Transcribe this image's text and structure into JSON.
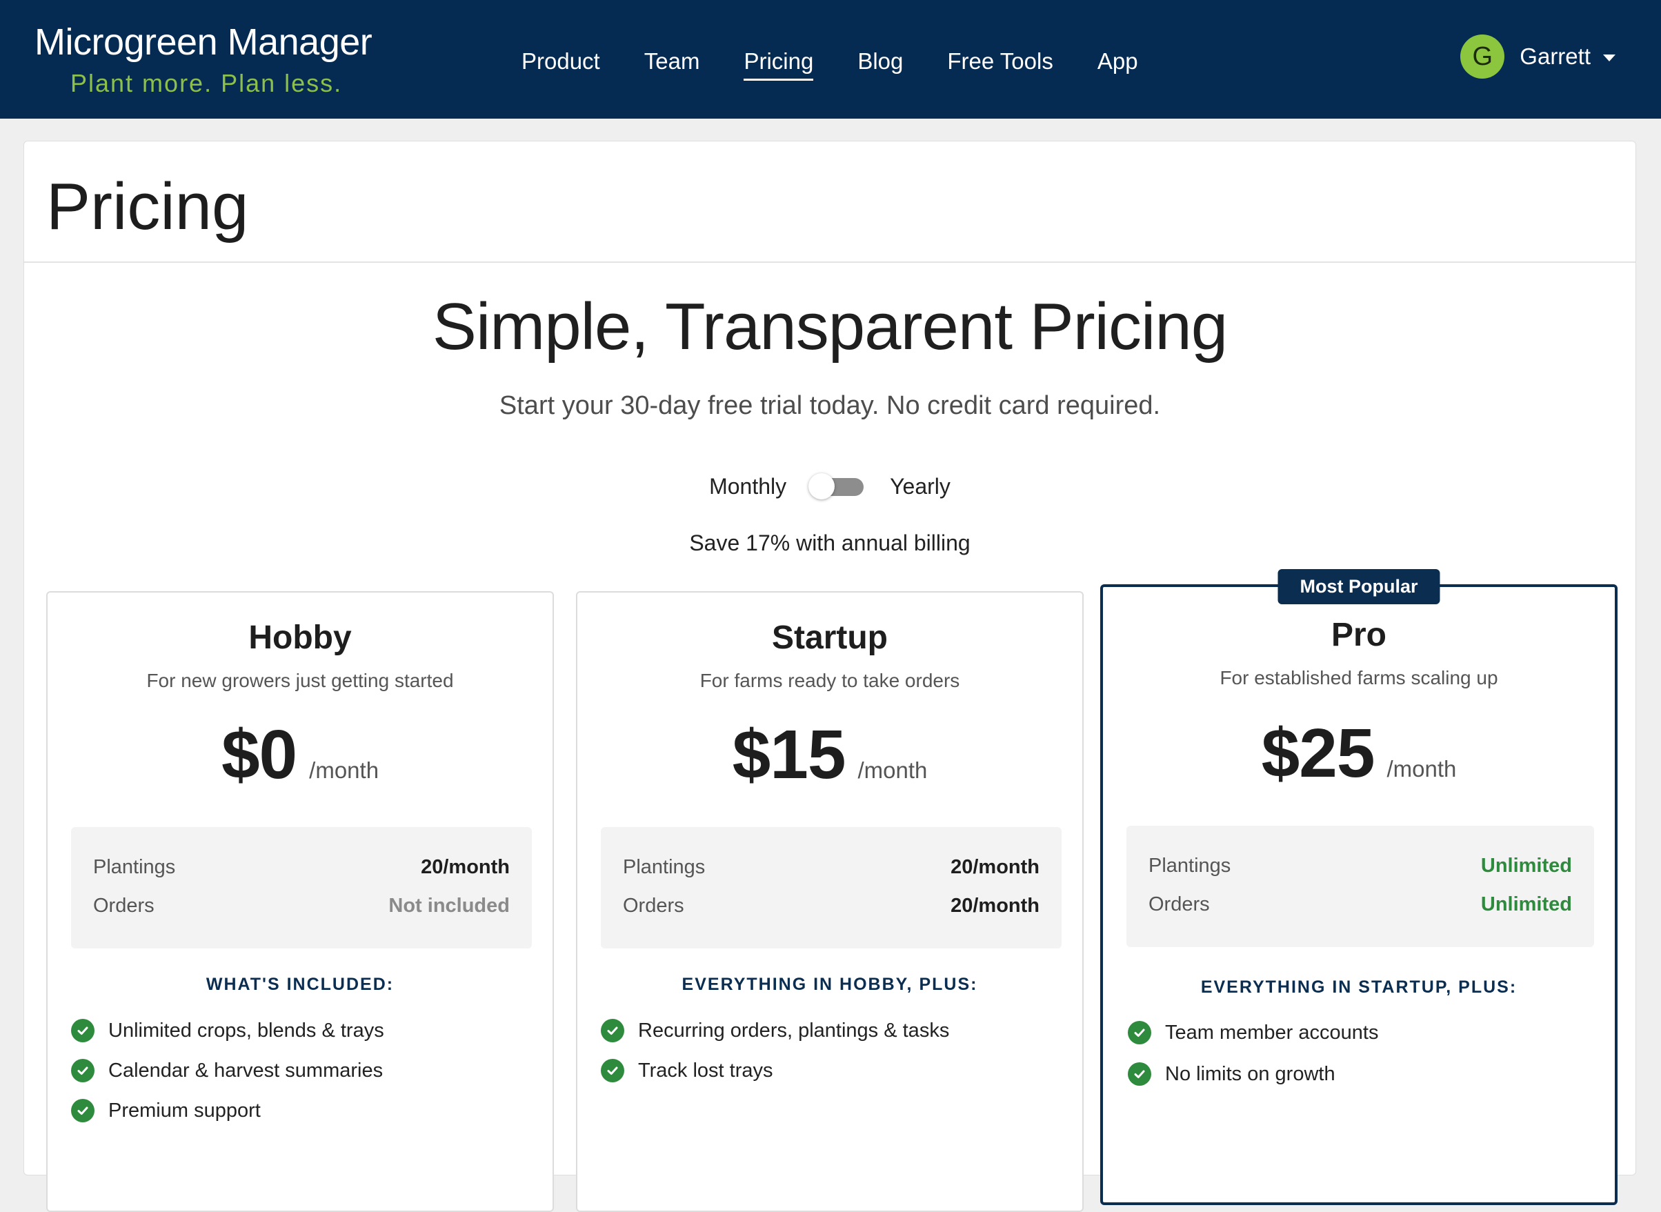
{
  "header": {
    "brand_title": "Microgreen Manager",
    "brand_tagline": "Plant more. Plan less.",
    "nav": [
      {
        "label": "Product"
      },
      {
        "label": "Team"
      },
      {
        "label": "Pricing",
        "active": true
      },
      {
        "label": "Blog"
      },
      {
        "label": "Free Tools"
      },
      {
        "label": "App"
      }
    ],
    "user": {
      "initial": "G",
      "name": "Garrett"
    }
  },
  "page": {
    "title": "Pricing",
    "hero_title": "Simple, Transparent Pricing",
    "hero_subtitle": "Start your 30-day free trial today. No credit card required.",
    "billing": {
      "monthly_label": "Monthly",
      "yearly_label": "Yearly",
      "yearly_selected": false,
      "save_note": "Save 17% with annual billing"
    }
  },
  "plans": [
    {
      "name": "Hobby",
      "description": "For new growers just getting started",
      "price": "$0",
      "period": "/month",
      "limits": [
        {
          "label": "Plantings",
          "value": "20/month",
          "style": "normal"
        },
        {
          "label": "Orders",
          "value": "Not included",
          "style": "muted"
        }
      ],
      "features_heading": "WHAT'S INCLUDED:",
      "features": [
        "Unlimited crops, blends & trays",
        "Calendar & harvest summaries",
        "Premium support"
      ]
    },
    {
      "name": "Startup",
      "description": "For farms ready to take orders",
      "price": "$15",
      "period": "/month",
      "limits": [
        {
          "label": "Plantings",
          "value": "20/month",
          "style": "normal"
        },
        {
          "label": "Orders",
          "value": "20/month",
          "style": "normal"
        }
      ],
      "features_heading": "EVERYTHING IN HOBBY, PLUS:",
      "features": [
        "Recurring orders, plantings & tasks",
        "Track lost trays"
      ]
    },
    {
      "name": "Pro",
      "badge": "Most Popular",
      "description": "For established farms scaling up",
      "price": "$25",
      "period": "/month",
      "limits": [
        {
          "label": "Plantings",
          "value": "Unlimited",
          "style": "green"
        },
        {
          "label": "Orders",
          "value": "Unlimited",
          "style": "green"
        }
      ],
      "features_heading": "EVERYTHING IN STARTUP, PLUS:",
      "features": [
        "Team member accounts",
        "No limits on growth"
      ]
    }
  ],
  "colors": {
    "navy": "#062b52",
    "accent_green": "#8cc04a",
    "check_green": "#2e8b3e"
  },
  "icons": {
    "check": "check-circle-icon",
    "caret": "chevron-down-icon"
  }
}
